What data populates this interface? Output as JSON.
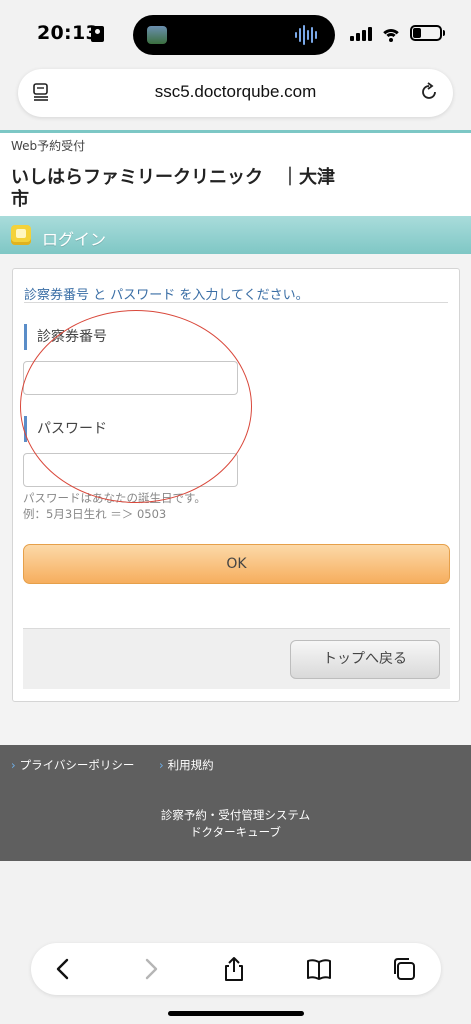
{
  "status_bar": {
    "time": "20:13"
  },
  "browser": {
    "url": "ssc5.doctorqube.com"
  },
  "header": {
    "web_label": "Web予約受付",
    "clinic_name": "いしはらファミリークリニック　｜大津市"
  },
  "login": {
    "title": "ログイン",
    "instruction": "診察券番号 と パスワード を入力してください。",
    "card_number_label": "診察券番号",
    "card_number_value": "",
    "password_label": "パスワード",
    "password_value": "",
    "hint_line1": "パスワードはあなたの誕生日です。",
    "hint_line2": "例：5月3日生れ ＝＞ 0503",
    "ok_label": "OK",
    "back_label": "トップへ戻る"
  },
  "footer": {
    "links": [
      "プライバシーポリシー",
      "利用規約"
    ],
    "system_line1": "診察予約・受付管理システム",
    "system_line2": "ドクターキューブ"
  },
  "icons": {
    "reader": "reader-icon",
    "reload": "reload-icon",
    "back": "back-arrow-icon",
    "forward": "forward-arrow-icon",
    "share": "share-icon",
    "bookmarks": "book-icon",
    "tabs": "tabs-icon"
  },
  "colors": {
    "teal_band": "#7fc7c5",
    "ok_button": "#f6ae5e",
    "label_bar": "#5a8dc8",
    "footer_bg": "#5f5f5f",
    "annotation": "#d9483b"
  }
}
